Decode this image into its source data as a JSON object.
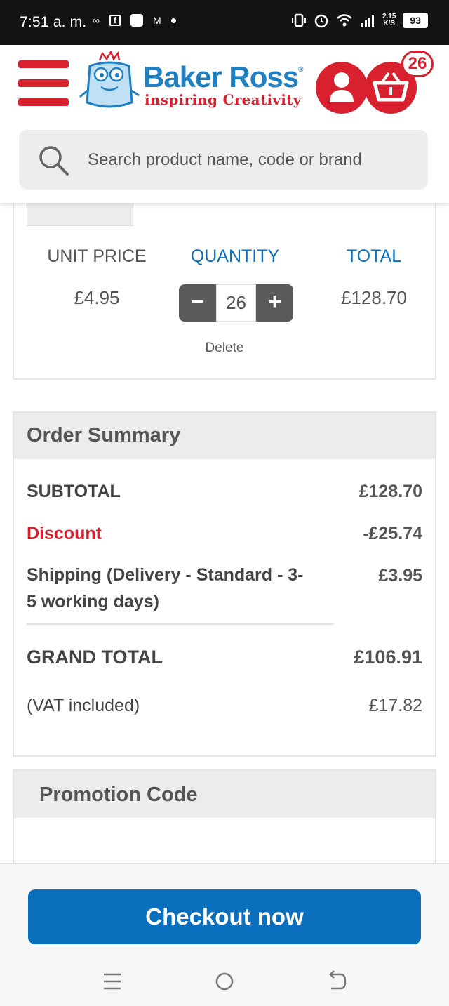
{
  "status_bar": {
    "time": "7:51 a. m.",
    "speed_top": "2.15",
    "speed_unit": "K/S",
    "battery": "93"
  },
  "header": {
    "brand_name": "Baker Ross",
    "brand_mark": "®",
    "tagline": "inspiring Creativity",
    "basket_count": "26"
  },
  "search": {
    "placeholder": "Search product name, code or brand"
  },
  "cart_item": {
    "columns": {
      "unit_price": "UNIT PRICE",
      "quantity": "QUANTITY",
      "total": "TOTAL"
    },
    "unit_price": "£4.95",
    "quantity": "26",
    "total": "£128.70",
    "minus_label": "−",
    "plus_label": "+",
    "delete_label": "Delete"
  },
  "order_summary": {
    "title": "Order Summary",
    "subtotal_label": "SUBTOTAL",
    "subtotal_value": "£128.70",
    "discount_label": "Discount",
    "discount_value": "-£25.74",
    "shipping_label_line1": "Shipping (Delivery - Standard - 3-",
    "shipping_label_line2": "5 working days)",
    "shipping_value": "£3.95",
    "grand_total_label": "GRAND TOTAL",
    "grand_total_value": "£106.91",
    "vat_label": "(VAT included)",
    "vat_value": "£17.82"
  },
  "promotion": {
    "title": "Promotion Code"
  },
  "checkout": {
    "label": "Checkout now"
  },
  "colors": {
    "brand_red": "#d9202f",
    "brand_blue": "#1e7fc3",
    "checkout_blue": "#0a6fbd",
    "column_head_blue": "#0a6fbd"
  }
}
